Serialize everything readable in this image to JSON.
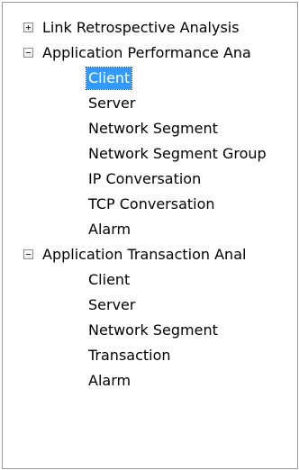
{
  "tree": {
    "groups": [
      {
        "label": "Link Retrospective Analysis",
        "expanded": false,
        "toggle_icon": "plus-expand-icon",
        "children": []
      },
      {
        "label": "Application Performance Ana",
        "expanded": true,
        "toggle_icon": "minus-collapse-icon",
        "children": [
          {
            "label": "Client",
            "selected": true
          },
          {
            "label": "Server",
            "selected": false
          },
          {
            "label": "Network Segment",
            "selected": false
          },
          {
            "label": "Network Segment Group",
            "selected": false
          },
          {
            "label": "IP Conversation",
            "selected": false
          },
          {
            "label": "TCP Conversation",
            "selected": false
          },
          {
            "label": "Alarm",
            "selected": false
          }
        ]
      },
      {
        "label": "Application Transaction Anal",
        "expanded": true,
        "toggle_icon": "minus-collapse-icon",
        "children": [
          {
            "label": "Client",
            "selected": false
          },
          {
            "label": "Server",
            "selected": false
          },
          {
            "label": "Network Segment",
            "selected": false
          },
          {
            "label": "Transaction",
            "selected": false
          },
          {
            "label": "Alarm",
            "selected": false
          }
        ]
      }
    ],
    "colors": {
      "selection_bg": "#3399ff",
      "selection_text": "#ffffff",
      "border": "#9a9a9a"
    }
  }
}
